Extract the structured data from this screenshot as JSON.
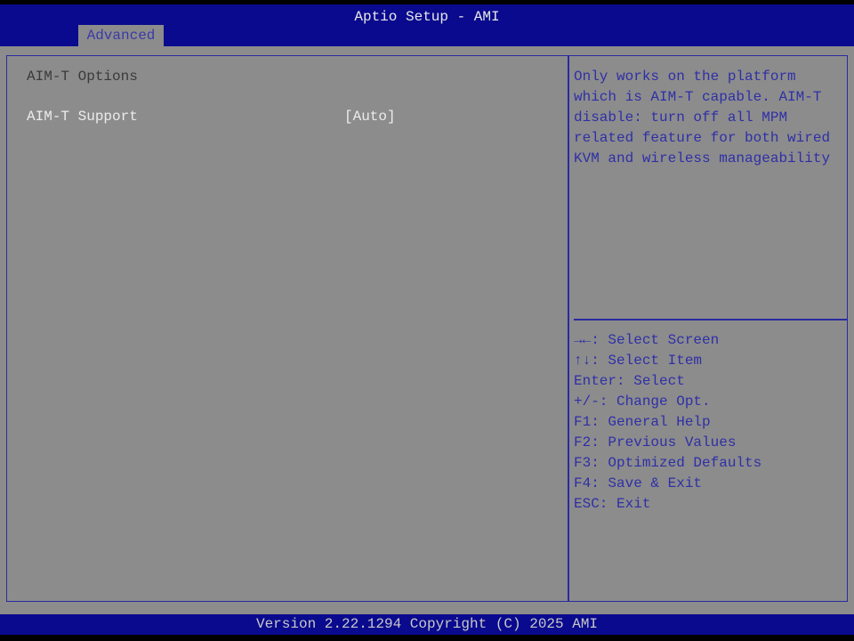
{
  "header": {
    "title": "Aptio Setup - AMI",
    "tabs": [
      {
        "label": "Advanced",
        "active": true
      }
    ]
  },
  "main": {
    "section_title": "AIM-T Options",
    "items": [
      {
        "label": "AIM-T Support",
        "value": "[Auto]",
        "selected": true
      }
    ]
  },
  "help": {
    "description": [
      "Only works on the platform",
      "which is AIM-T capable. AIM-T",
      "disable: turn off all MPM",
      "related feature for both wired",
      "KVM and wireless manageability"
    ],
    "keys": [
      "→←: Select Screen",
      "↑↓: Select Item",
      "Enter: Select",
      "+/-: Change Opt.",
      "F1: General Help",
      "F2: Previous Values",
      "F3: Optimized Defaults",
      "F4: Save & Exit",
      "ESC: Exit"
    ]
  },
  "footer": {
    "text": "Version 2.22.1294 Copyright (C) 2025 AMI"
  },
  "colors": {
    "header_bg": "#0a0a8e",
    "panel_bg": "#8c8c8c",
    "help_text": "#2f2fa8"
  }
}
